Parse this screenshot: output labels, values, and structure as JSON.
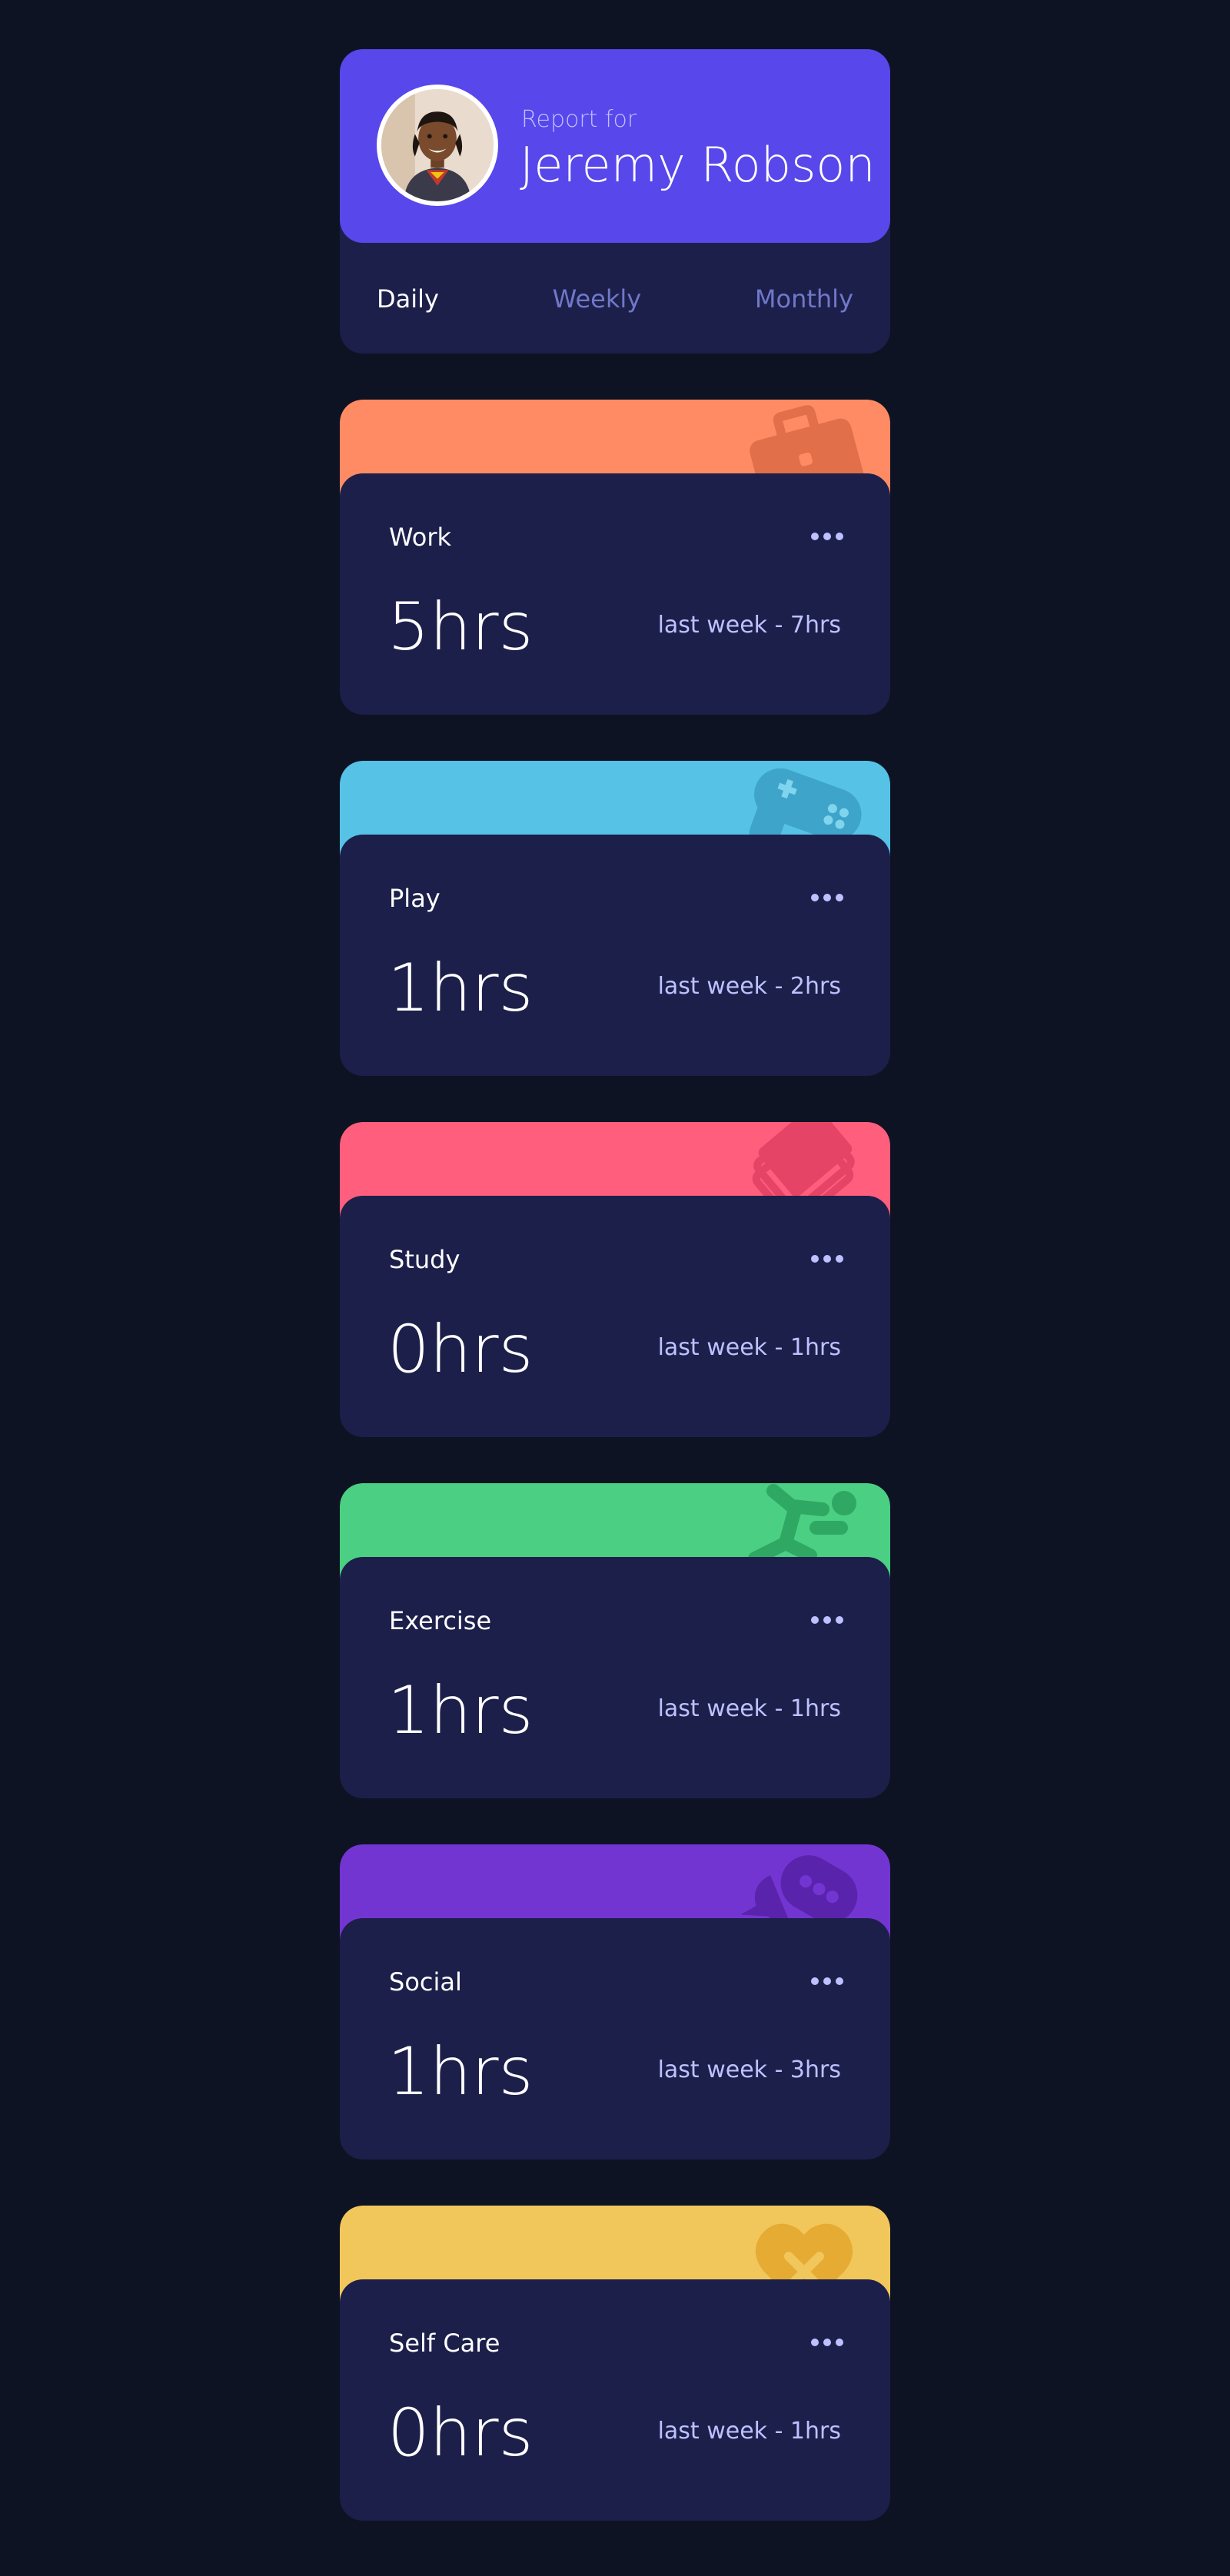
{
  "profile": {
    "report_for": "Report for",
    "name": "Jeremy Robson",
    "tabs": [
      {
        "label": "Daily",
        "active": true
      },
      {
        "label": "Weekly",
        "active": false
      },
      {
        "label": "Monthly",
        "active": false
      }
    ]
  },
  "cards": [
    {
      "title": "Work",
      "hours": "5hrs",
      "last_week": "last week - 7hrs",
      "color": "#ff8b64",
      "icon": "briefcase-icon"
    },
    {
      "title": "Play",
      "hours": "1hrs",
      "last_week": "last week - 2hrs",
      "color": "#55c2e6",
      "icon": "gamepad-icon"
    },
    {
      "title": "Study",
      "hours": "0hrs",
      "last_week": "last week - 1hrs",
      "color": "#ff5e7d",
      "icon": "books-icon"
    },
    {
      "title": "Exercise",
      "hours": "1hrs",
      "last_week": "last week - 1hrs",
      "color": "#4bcf82",
      "icon": "running-icon"
    },
    {
      "title": "Social",
      "hours": "1hrs",
      "last_week": "last week - 3hrs",
      "color": "#7335d2",
      "icon": "chat-bubbles-icon"
    },
    {
      "title": "Self Care",
      "hours": "0hrs",
      "last_week": "last week - 1hrs",
      "color": "#f1c75b",
      "icon": "heart-bandage-icon"
    }
  ],
  "colors": {
    "background": "#0e1323",
    "card": "#1c1f4a",
    "accent": "#5847eb",
    "muted": "#7078c9",
    "pale": "#bdc1ff"
  }
}
